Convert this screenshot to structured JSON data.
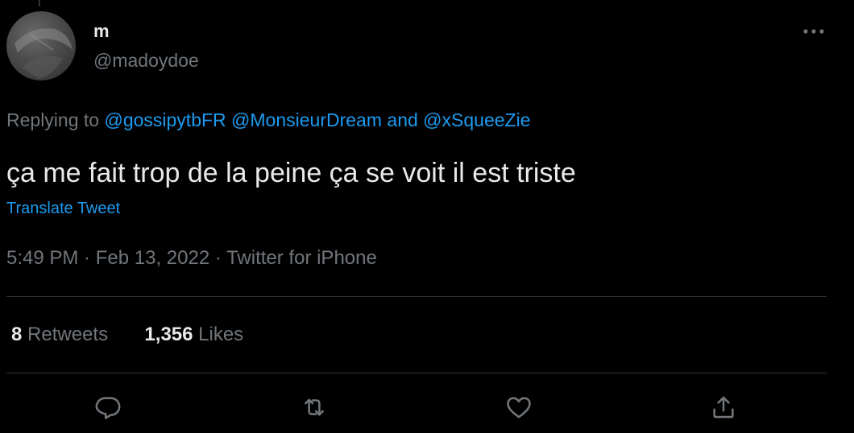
{
  "author": {
    "display_name": "m",
    "handle": "@madoydoe"
  },
  "reply": {
    "prefix": "Replying to ",
    "mentions": [
      "@gossipytbFR",
      "@MonsieurDream",
      "@xSqueeZie"
    ],
    "joiner_space": " ",
    "joiner_and": " and "
  },
  "tweet": {
    "text": "ça me fait trop de la peine ça se voit il est triste",
    "translate_label": "Translate Tweet"
  },
  "meta": {
    "time": "5:49 PM",
    "separator": " · ",
    "date": "Feb 13, 2022",
    "source": "Twitter for iPhone"
  },
  "stats": {
    "retweets_count": "8",
    "retweets_label": " Retweets",
    "likes_count": "1,356",
    "likes_label": " Likes"
  },
  "icons": {
    "more": "more-horizontal-icon",
    "reply": "reply-icon",
    "retweet": "retweet-icon",
    "like": "heart-icon",
    "share": "share-icon"
  },
  "colors": {
    "background": "#000000",
    "text_primary": "#e7e9ea",
    "text_secondary": "#71767b",
    "accent": "#1d9bf0",
    "divider": "#2f3336"
  }
}
